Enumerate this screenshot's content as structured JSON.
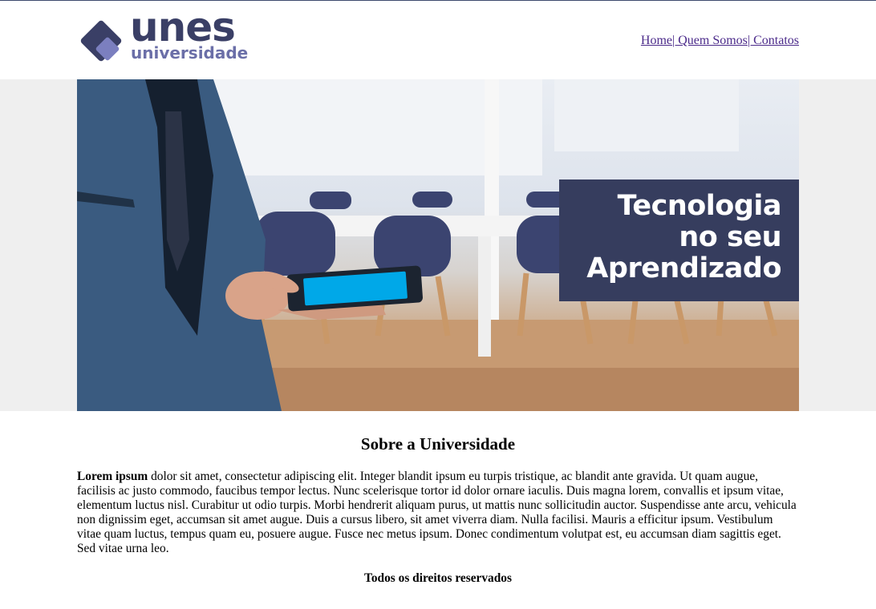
{
  "logo": {
    "main": "unes",
    "sub": "universidade"
  },
  "nav": {
    "items": [
      "Home",
      "| Quem Somos",
      "| Contatos"
    ]
  },
  "hero": {
    "banner_lines": [
      "Tecnologia",
      "no seu",
      "Aprendizado"
    ],
    "colors": {
      "banner": "#363d5e",
      "tablet_screen": "#00a8e8"
    }
  },
  "about": {
    "title": "Sobre a Universidade",
    "lead": "Lorem ipsum",
    "text": " dolor sit amet, consectetur adipiscing elit. Integer blandit ipsum eu turpis tristique, ac blandit ante gravida. Ut quam augue, facilisis ac justo commodo, faucibus tempor lectus. Nunc scelerisque tortor id dolor ornare iaculis. Duis magna lorem, convallis et ipsum vitae, elementum luctus nisl. Curabitur ut odio turpis. Morbi hendrerit aliquam purus, ut mattis nunc sollicitudin auctor. Suspendisse ante arcu, vehicula non dignissim eget, accumsan sit amet augue. Duis a cursus libero, sit amet viverra diam. Nulla facilisi. Mauris a efficitur ipsum. Vestibulum vitae quam luctus, tempus quam eu, posuere augue. Fusce nec metus ipsum. Donec condimentum volutpat est, eu accumsan diam sagittis eget. Sed vitae urna leo."
  },
  "footer": {
    "text": "Todos os direitos reservados"
  },
  "colors": {
    "brand_dark": "#3a3f66",
    "brand_light": "#6b6fa8",
    "link": "#4b2a8a"
  }
}
